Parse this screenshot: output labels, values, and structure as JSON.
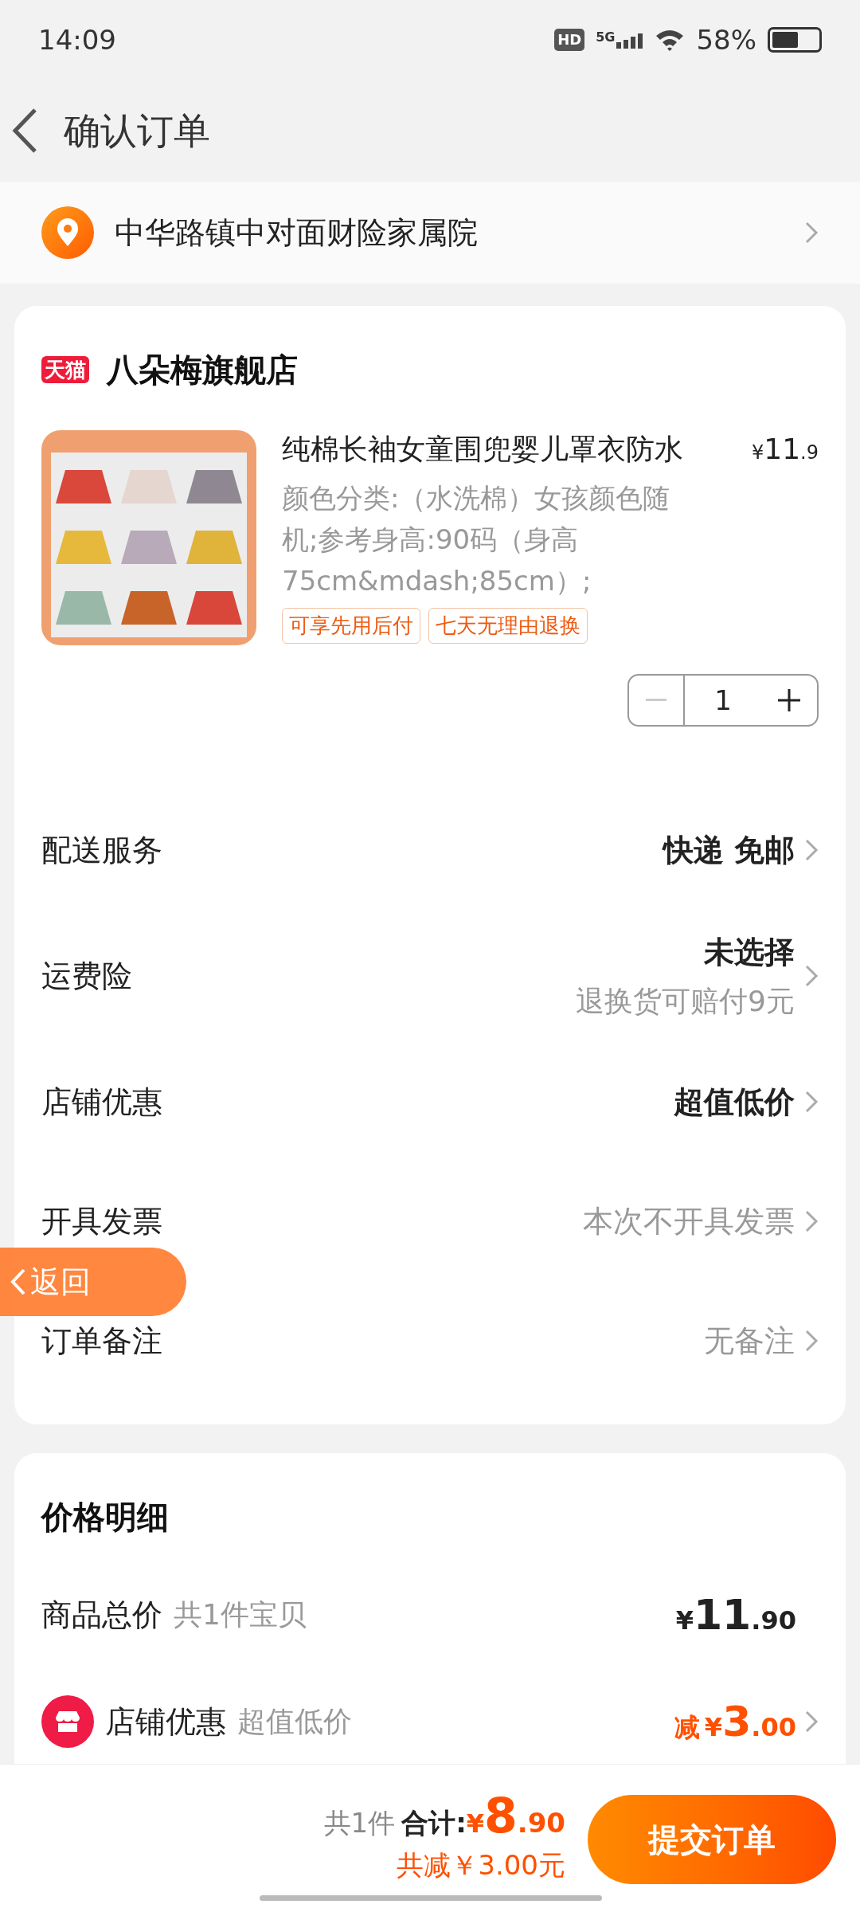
{
  "status_bar": {
    "time": "14:09",
    "hd_badge": "HD",
    "network": "5G",
    "battery": "58%"
  },
  "header": {
    "title": "确认订单"
  },
  "address": {
    "text": "中华路镇中对面财险家属院"
  },
  "store": {
    "badge": "天猫",
    "name": "八朵梅旗舰店"
  },
  "product": {
    "kind": "picture",
    "title": "纯棉长袖女童围兜婴儿罩衣防水",
    "price": {
      "currency": "¥",
      "integer": "11",
      "decimal": ".9"
    },
    "spec": "颜色分类:（水洗棉）女孩颜色随机;参考身高:90码（身高75cm&mdash;85cm）;",
    "tags": [
      "可享先用后付",
      "七天无理由退换"
    ],
    "quantity": "1",
    "minus_disabled": true
  },
  "options": [
    {
      "label": "配送服务",
      "value": "快递 免邮",
      "muted": false
    },
    {
      "label": "运费险",
      "value": "未选择",
      "muted": false,
      "sub": "退换货可赔付9元"
    },
    {
      "label": "店铺优惠",
      "value": "超值低价",
      "muted": false
    },
    {
      "label": "开具发票",
      "value": "本次不开具发票",
      "muted": true
    },
    {
      "label": "订单备注",
      "value": "无备注",
      "muted": true
    }
  ],
  "price_detail": {
    "title": "价格明细",
    "rows": [
      {
        "kind": "total",
        "label": "商品总价",
        "note": "共1件宝贝",
        "currency": "¥",
        "integer": "11",
        "decimal": ".90"
      },
      {
        "kind": "discount",
        "label": "店铺优惠",
        "note": "超值低价",
        "prefix": "减",
        "currency": "¥",
        "integer": "3",
        "decimal": ".00"
      }
    ]
  },
  "bottom_bar": {
    "count": "共1件",
    "total_label": "合计:",
    "currency": "¥",
    "integer": "8",
    "decimal": ".90",
    "saving": "共减￥3.00元",
    "submit": "提交订单"
  },
  "floating_back": {
    "label": "返回"
  }
}
